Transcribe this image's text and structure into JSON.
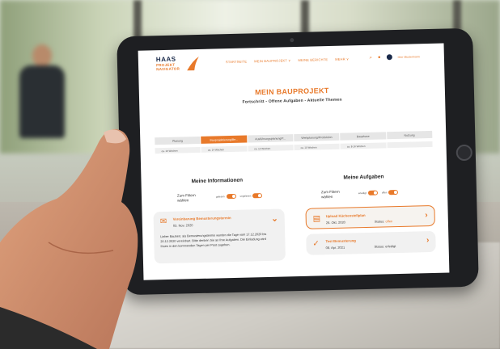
{
  "app": {
    "logo": {
      "line1": "HAAS",
      "line2": "PROJEKT",
      "line3": "NAVIGATOR"
    },
    "nav": [
      "STARTSEITE",
      "MEIN BAUPROJEKT ∨",
      "MEINE BERICHTE",
      "MEHR ∨"
    ],
    "user_name": "Herr Mustermann",
    "title": "MEIN BAUPROJEKT",
    "subtitle": "Fortschritt - Offene Aufgaben - Aktuelle Themen",
    "phases": [
      {
        "label": "Planung",
        "active": false
      },
      {
        "label": "Bauprojektierung/Be...",
        "active": true
      },
      {
        "label": "Ausführungsplanung/F...",
        "active": false
      },
      {
        "label": "Werkplanung/Produktion",
        "active": false
      },
      {
        "label": "Bauphase",
        "active": false
      },
      {
        "label": "Nutzung",
        "active": false
      }
    ],
    "durations": [
      "ca. 16 Wochen",
      "ca. 14 Wochen",
      "ca. 12 Wochen",
      "ca. 10 Wochen",
      "ca. 8-16 Wochen",
      ""
    ],
    "info": {
      "title": "Meine Informationen",
      "filter_label": "Zum Filtern wählen",
      "toggles": [
        "gelesen",
        "ungelesen"
      ],
      "card": {
        "title": "Vereinbarung Bemusterungstermin",
        "date": "03. Nov. 2020",
        "body": "Lieber Bauherr, als Bemusterungstermin wurden die Tage vom 17.12.2020 bis 20.12.2020 vereinbart. Bitte denken Sie an Ihre Aufgaben. Die Einladung wird Ihnen in den kommenden Tagen per Post zugehen."
      }
    },
    "tasks": {
      "title": "Meine Aufgaben",
      "filter_label": "Zum Filtern wählen",
      "toggles": [
        "erledigt",
        "offen"
      ],
      "items": [
        {
          "title": "Upload Küchenstellplan",
          "date": "26. Okt. 2020",
          "status_label": "Status:",
          "status": "offen"
        },
        {
          "title": "Test Bemusterung",
          "date": "08. Apr. 2021",
          "status_label": "Status:",
          "status": "erledigt"
        }
      ]
    }
  },
  "colors": {
    "accent": "#e8792a",
    "navy": "#1a2a4a"
  }
}
